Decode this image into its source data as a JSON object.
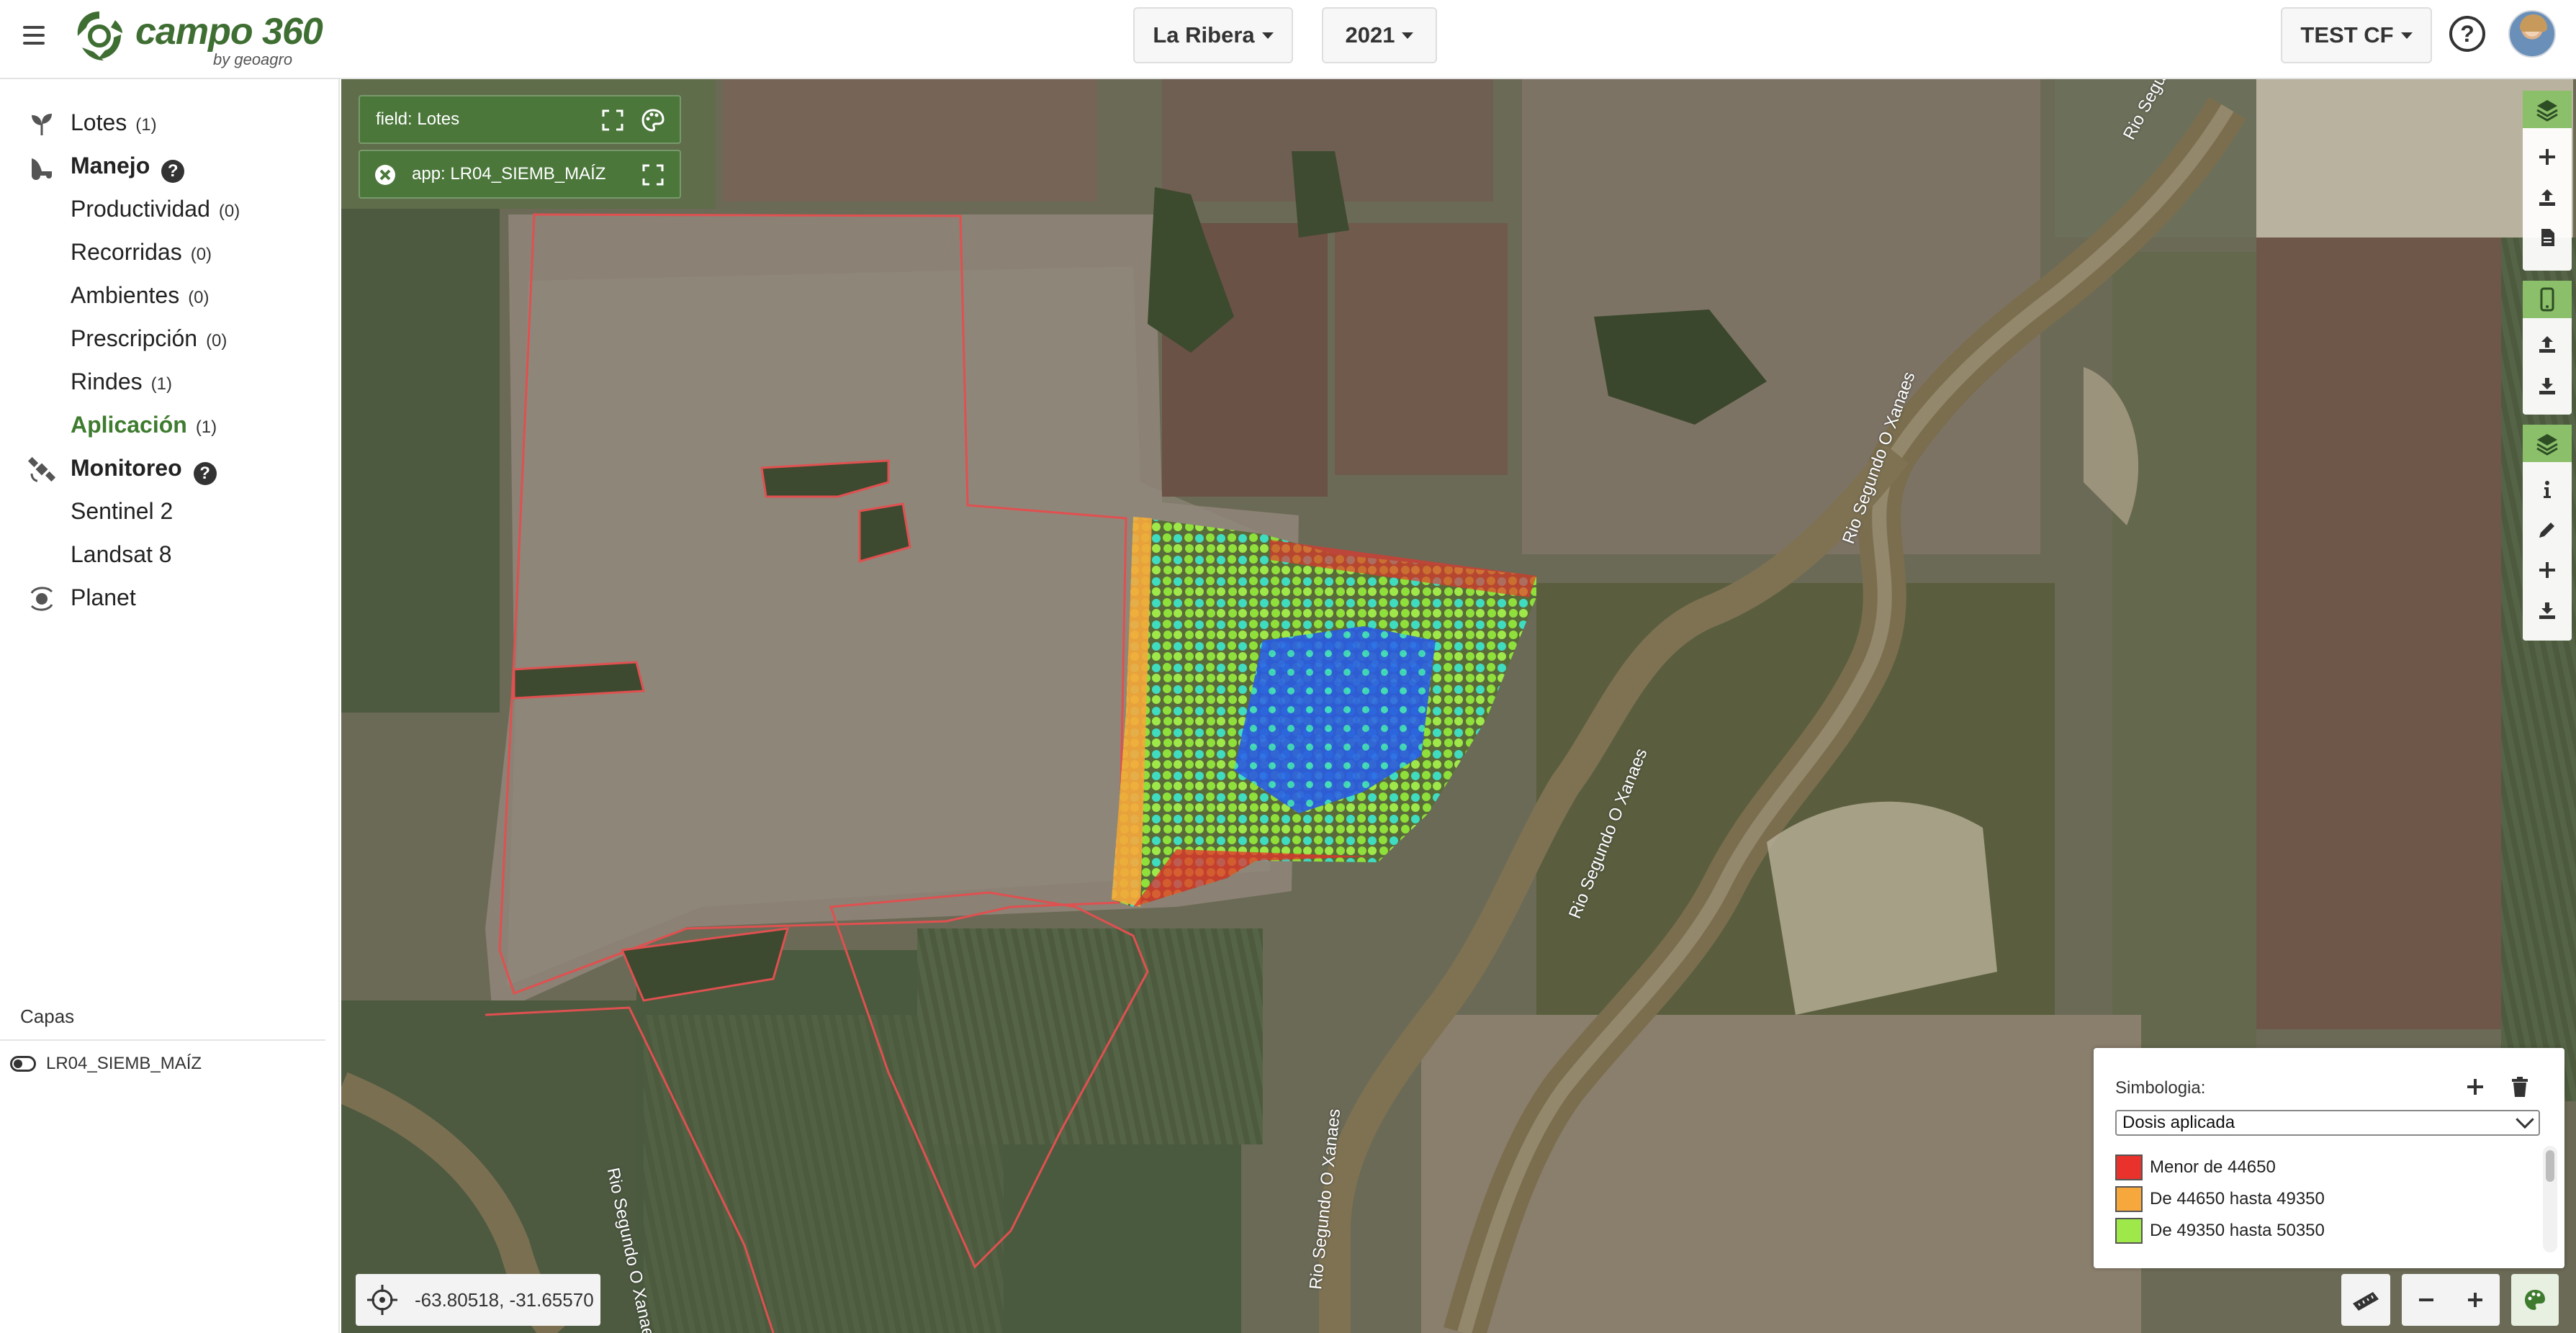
{
  "header": {
    "brand": "campo 360",
    "brand_sub": "by geoagro",
    "campo_select": "La Ribera",
    "year_select": "2021",
    "user_select": "TEST CF",
    "help_label": "?"
  },
  "sidebar": {
    "lotes": {
      "label": "Lotes",
      "count": "(1)"
    },
    "manejo": {
      "label": "Manejo"
    },
    "manejo_items": [
      {
        "label": "Productividad",
        "count": "(0)"
      },
      {
        "label": "Recorridas",
        "count": "(0)"
      },
      {
        "label": "Ambientes",
        "count": "(0)"
      },
      {
        "label": "Prescripción",
        "count": "(0)"
      },
      {
        "label": "Rindes",
        "count": "(1)"
      },
      {
        "label": "Aplicación",
        "count": "(1)"
      }
    ],
    "monitoreo": {
      "label": "Monitoreo"
    },
    "monitoreo_items": [
      {
        "label": "Sentinel 2"
      },
      {
        "label": "Landsat 8"
      }
    ],
    "planet": {
      "label": "Planet"
    },
    "capas_header": "Capas",
    "layers": [
      {
        "label": "LR04_SIEMB_MAÍZ"
      }
    ]
  },
  "map": {
    "field_chip": "field: Lotes",
    "app_chip": "app: LR04_SIEMB_MAÍZ",
    "coordinates": "-63.80518, -31.65570",
    "river_labels": [
      "Rio Segundo",
      "Rio Segundo O Xanaes",
      "Rio Segundo O Xanaes",
      "Rio Segundo O Xanaes",
      "Rio Segundo O Xanaes"
    ],
    "symbology": {
      "title": "Simbologia:",
      "selected": "Dosis aplicada",
      "legend": [
        {
          "label": "Menor de 44650",
          "color": "#e8322b"
        },
        {
          "label": "De 44650 hasta 49350",
          "color": "#f6a83c"
        },
        {
          "label": "De 49350 hasta 50350",
          "color": "#9fe84a"
        }
      ]
    }
  },
  "colors": {
    "brand_green": "#3e7b2f",
    "chip_green": "#4a783a",
    "dose_red": "#e8322b",
    "dose_orange": "#f6a83c",
    "dose_green": "#8fe03a",
    "dose_cyan": "#3fdcc0",
    "dose_blue": "#2a5ce0"
  }
}
